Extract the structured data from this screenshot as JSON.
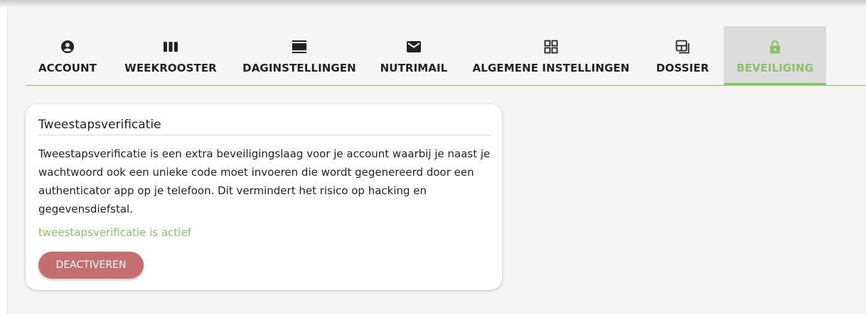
{
  "tabs": [
    {
      "label": "ACCOUNT",
      "icon": "account-circle-icon"
    },
    {
      "label": "WEEKROOSTER",
      "icon": "view-week-icon"
    },
    {
      "label": "DAGINSTELLINGEN",
      "icon": "view-day-icon"
    },
    {
      "label": "NUTRIMAIL",
      "icon": "mail-icon"
    },
    {
      "label": "ALGEMENE INSTELLINGEN",
      "icon": "grid-icon"
    },
    {
      "label": "DOSSIER",
      "icon": "dossier-icon"
    },
    {
      "label": "BEVEILIGING",
      "icon": "lock-icon",
      "active": true
    }
  ],
  "security_card": {
    "title": "Tweestapsverificatie",
    "description": "Tweestapsverificatie is een extra beveiligingslaag voor je account waarbij je naast je wachtwoord ook een unieke code moet invoeren die wordt gegenereerd door een authenticator app op je telefoon. Dit vermindert het risico op hacking en gegevensdiefstal.",
    "status": "tweestapsverificatie is actief",
    "button_label": "DEACTIVEREN"
  },
  "colors": {
    "accent": "#8bc26a",
    "danger_button": "#c46f6f",
    "background": "#f5f5f5"
  }
}
